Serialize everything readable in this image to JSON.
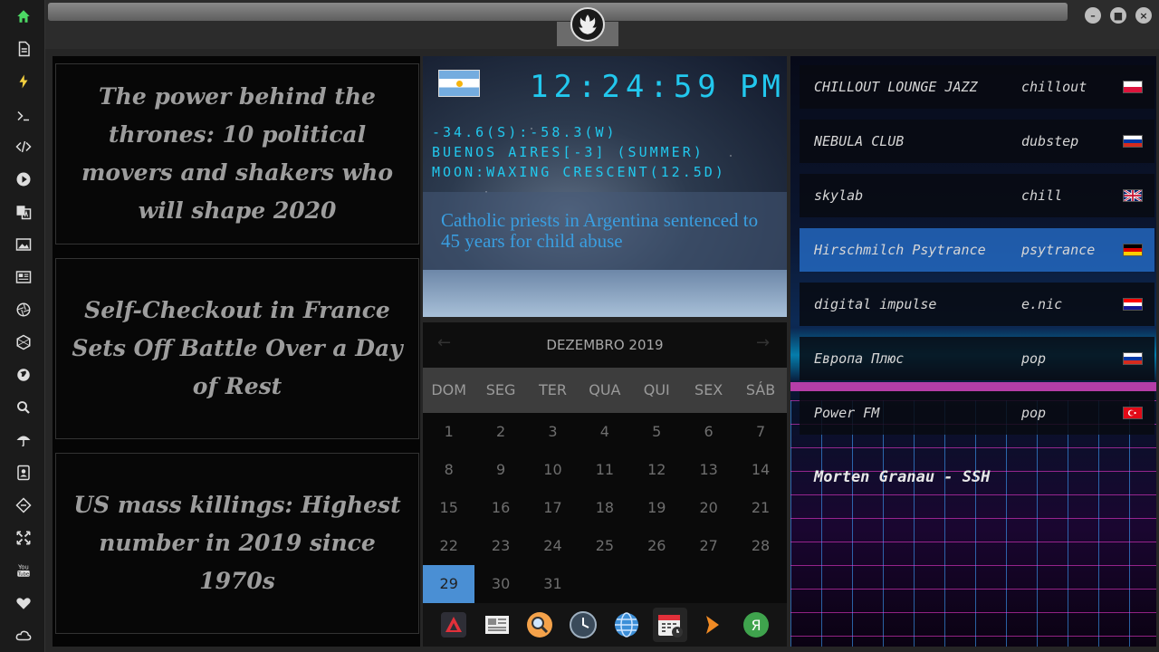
{
  "news": [
    {
      "title": "The power behind the thrones: 10 political movers and shakers who will shape 2020"
    },
    {
      "title": "Self-Checkout in France Sets Off Battle Over a Day of Rest"
    },
    {
      "title": "US mass killings: Highest number in 2019 since 1970s"
    }
  ],
  "clock": {
    "time": "12:24:59",
    "ampm": "PM",
    "coords": "-34.6(S):-58.3(W)",
    "location": "BUENOS AIRES[-3] (SUMMER)",
    "moon": "MOON:WAXING CRESCENT(12.5D)",
    "headline": "Catholic priests in Argentina sentenced to 45 years for child abuse"
  },
  "calendar": {
    "month_label": "DEZEMBRO 2019",
    "weekdays": [
      "DOM",
      "SEG",
      "TER",
      "QUA",
      "QUI",
      "SEX",
      "SÁB"
    ],
    "weeks": [
      [
        "1",
        "2",
        "3",
        "4",
        "5",
        "6",
        "7"
      ],
      [
        "8",
        "9",
        "10",
        "11",
        "12",
        "13",
        "14"
      ],
      [
        "15",
        "16",
        "17",
        "18",
        "19",
        "20",
        "21"
      ],
      [
        "22",
        "23",
        "24",
        "25",
        "26",
        "27",
        "28"
      ],
      [
        "29",
        "30",
        "31",
        "",
        "",
        "",
        ""
      ]
    ],
    "today": "29"
  },
  "radio": {
    "stations": [
      {
        "name": "CHILLOUT LOUNGE JAZZ",
        "genre": "chillout",
        "flag": "poland"
      },
      {
        "name": "NEBULA CLUB",
        "genre": "dubstep",
        "flag": "russia"
      },
      {
        "name": "skylab",
        "genre": "chill",
        "flag": "uk"
      },
      {
        "name": "Hirschmilch Psytrance",
        "genre": "psytrance",
        "flag": "germany"
      },
      {
        "name": "digital impulse",
        "genre": "e.nic",
        "flag": "croatia"
      },
      {
        "name": "Европа Плюс",
        "genre": "pop",
        "flag": "russia"
      },
      {
        "name": "Power FM",
        "genre": "pop",
        "flag": "turkey"
      }
    ],
    "selected_index": 3,
    "now_playing": "Morten Granau - SSH"
  },
  "window_buttons": [
    "minimize",
    "maximize",
    "close"
  ],
  "colors": {
    "clock_digits": "#22c8ee",
    "headline": "#3a9ee0",
    "today_highlight": "#4a8fd4"
  }
}
